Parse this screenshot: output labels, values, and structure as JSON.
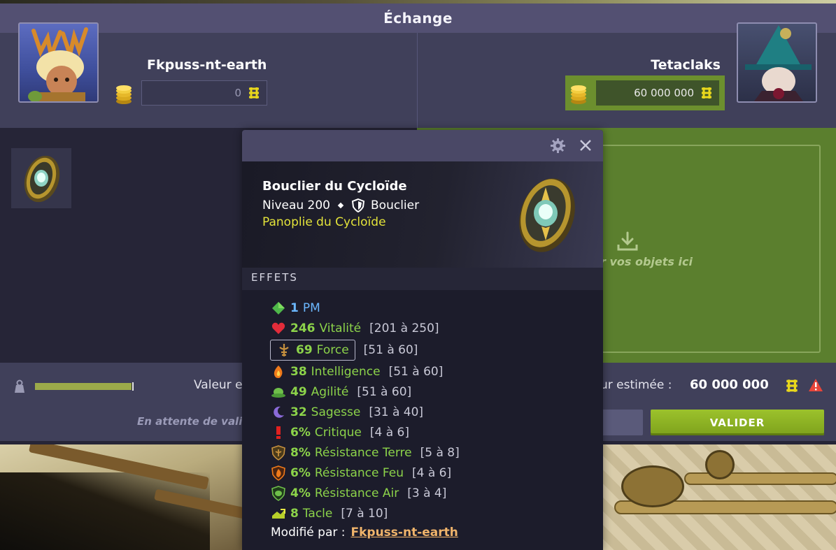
{
  "window": {
    "title": "Échange"
  },
  "left_player": {
    "name": "Fkpuss-nt-earth",
    "kamas": "0"
  },
  "right_player": {
    "name": "Tetaclaks",
    "kamas": "60 000 000"
  },
  "drop_zone": {
    "text": "r vos objets ici"
  },
  "footer": {
    "progress": 0.98,
    "value_label_left": "Valeur e",
    "waiting_text": "En attente de valida",
    "value_label_right": "ur estimée :",
    "value_amount": "60 000 000",
    "validate_label": "VALIDER"
  },
  "tooltip": {
    "item_name": "Bouclier du Cycloïde",
    "level": "Niveau 200",
    "item_type": "Bouclier",
    "set_name": "Panoplie du Cycloïde",
    "effects_header": "EFFETS",
    "effects": [
      {
        "icon": "pm-icon",
        "amount": "1",
        "stat": "PM",
        "range": ""
      },
      {
        "icon": "vitality-icon",
        "amount": "246",
        "stat": "Vitalité",
        "range": "[201 à 250]"
      },
      {
        "icon": "strength-icon",
        "amount": "69",
        "stat": "Force",
        "range": "[51 à 60]"
      },
      {
        "icon": "intelligence-icon",
        "amount": "38",
        "stat": "Intelligence",
        "range": "[51 à 60]"
      },
      {
        "icon": "agility-icon",
        "amount": "49",
        "stat": "Agilité",
        "range": "[51 à 60]"
      },
      {
        "icon": "wisdom-icon",
        "amount": "32",
        "stat": "Sagesse",
        "range": "[31 à 40]"
      },
      {
        "icon": "critical-icon",
        "amount": "6%",
        "stat": "Critique",
        "range": "[4 à 6]"
      },
      {
        "icon": "earth-resistance-icon",
        "amount": "8%",
        "stat": "Résistance Terre",
        "range": "[5 à 8]"
      },
      {
        "icon": "fire-resistance-icon",
        "amount": "6%",
        "stat": "Résistance Feu",
        "range": "[4 à 6]"
      },
      {
        "icon": "air-resistance-icon",
        "amount": "4%",
        "stat": "Résistance Air",
        "range": "[3 à 4]"
      },
      {
        "icon": "lock-icon",
        "amount": "8",
        "stat": "Tacle",
        "range": "[7 à 10]"
      }
    ],
    "modified_by_label": "Modifié par :",
    "modified_by": "Fkpuss-nt-earth"
  },
  "colors": {
    "accent_green": "#7ea21c",
    "stat_green": "#8cd34a",
    "pm_blue": "#6bb7ff",
    "set_yellow": "#e3e33a",
    "link_orange": "#f0b46b"
  }
}
